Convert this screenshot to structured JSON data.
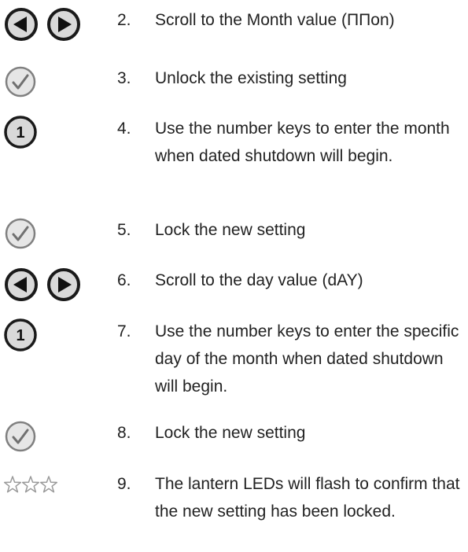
{
  "steps": [
    {
      "number": "2.",
      "text": "Scroll to the Month value (ΠΠon)",
      "icon": "arrow-pair-icon"
    },
    {
      "number": "3.",
      "text": "Unlock the existing setting",
      "icon": "check-icon"
    },
    {
      "number": "4.",
      "text": "Use the number keys to enter the month when dated shutdown will begin.",
      "icon": "number-1-key-icon"
    },
    {
      "number": "5.",
      "text": "Lock the new setting",
      "icon": "check-icon"
    },
    {
      "number": "6.",
      "text": "Scroll to the day value (dAY)",
      "icon": "arrow-pair-icon"
    },
    {
      "number": "7.",
      "text": "Use the number keys to enter the specific day of the month when dated shutdown will begin.",
      "icon": "number-1-key-icon"
    },
    {
      "number": "8.",
      "text": "Lock the new setting",
      "icon": "check-icon"
    },
    {
      "number": "9.",
      "text": "The lantern LEDs will flash to confirm that the new setting has been locked.",
      "icon": "three-stars-icon"
    }
  ],
  "icon_labels": {
    "number_key": "1"
  },
  "colors": {
    "text": "#222222",
    "button_fill": "#d9d9d9",
    "button_outline": "#1a1a1a",
    "arrow": "#111111",
    "check_button_fill": "#e6e6e6",
    "check_button_outline": "#808080",
    "star_outline": "#9a9a9a"
  }
}
